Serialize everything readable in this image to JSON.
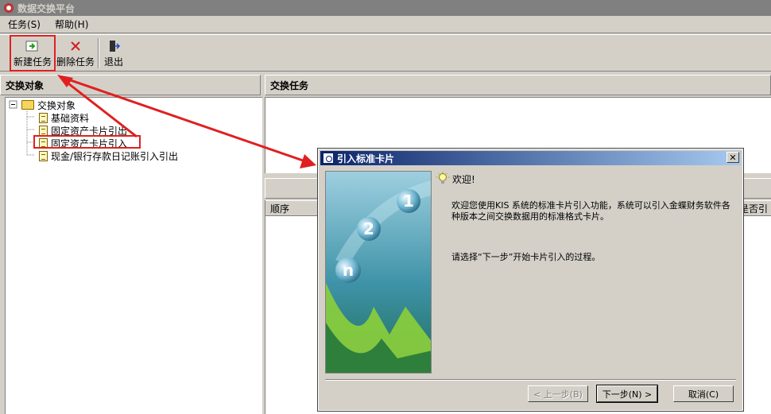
{
  "window": {
    "title": "数据交换平台"
  },
  "menu": [
    {
      "label": "任务(S)"
    },
    {
      "label": "帮助(H)"
    }
  ],
  "toolbar": {
    "new_task": "新建任务",
    "delete_task": "删除任务",
    "exit": "退出"
  },
  "left_panel": {
    "header": "交换对象",
    "tree": {
      "root": "交换对象",
      "children": [
        {
          "label": "基础资料"
        },
        {
          "label": "固定资产卡片引出"
        },
        {
          "label": "固定资产卡片引入"
        },
        {
          "label": "现金/银行存款日记账引入引出"
        }
      ]
    }
  },
  "right_panel": {
    "header": "交换任务",
    "columns": [
      {
        "label": "顺序"
      },
      {
        "label": "是否引"
      }
    ]
  },
  "dialog": {
    "title": "引入标准卡片",
    "welcome_title": "欢迎!",
    "paragraph1": "欢迎您使用KIS 系统的标准卡片引入功能，系统可以引入金蝶财务软件各种版本之间交换数据用的标准格式卡片。",
    "paragraph2": "请选择“下一步”开始卡片引入的过程。",
    "buttons": {
      "prev": "< 上一步(B)",
      "next": "下一步(N) >",
      "cancel": "取消(C)"
    },
    "image_numbers": [
      "1",
      "2",
      "n"
    ]
  },
  "colors": {
    "annotation": "#e02020",
    "title_active": "#0a246a",
    "title_inactive": "#808080"
  }
}
